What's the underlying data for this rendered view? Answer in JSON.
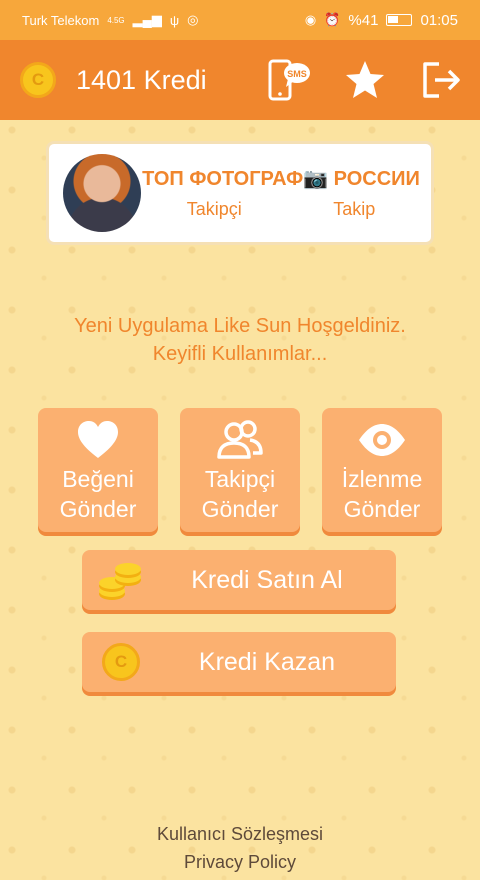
{
  "status_bar": {
    "carrier": "Turk Telekom",
    "network": "4.5G",
    "battery": "%41",
    "time": "01:05"
  },
  "header": {
    "credit_amount": "1401 Kredi",
    "coin_letter": "C",
    "icons": [
      "sms-phone-icon",
      "star-icon",
      "logout-icon"
    ]
  },
  "profile": {
    "name": "ТОП ФОТОГРАФ📷 РОССИИ",
    "followers_label": "Takipçi",
    "following_label": "Takip"
  },
  "welcome": {
    "line1": "Yeni Uygulama Like Sun Hoşgeldiniz.",
    "line2": "Keyifli Kullanımlar..."
  },
  "actions": [
    {
      "line1": "Beğeni",
      "line2": "Gönder",
      "icon": "heart-icon"
    },
    {
      "line1": "Takipçi",
      "line2": "Gönder",
      "icon": "users-icon"
    },
    {
      "line1": "İzlenme",
      "line2": "Gönder",
      "icon": "eye-icon"
    }
  ],
  "buy_credit": {
    "label": "Kredi Satın Al",
    "icon": "coin-stack-icon"
  },
  "earn_credit": {
    "label": "Kredi Kazan",
    "icon": "coin-icon",
    "coin_letter": "C"
  },
  "footer": {
    "terms": "Kullanıcı Sözleşmesi",
    "privacy": "Privacy Policy"
  },
  "colors": {
    "header": "#f0862d",
    "status_bar": "#f7a73b",
    "background": "#fbe3a0",
    "button": "#fbb070",
    "accent_text": "#f0862d"
  }
}
